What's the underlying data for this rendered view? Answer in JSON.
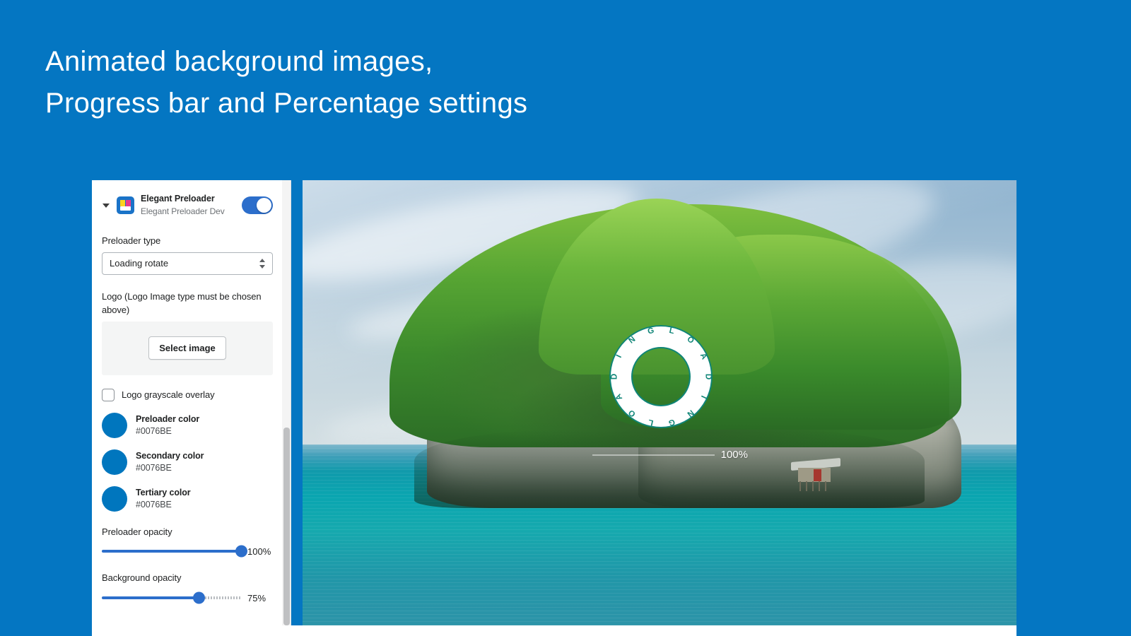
{
  "page": {
    "background_color": "#0476C2",
    "headline": "Animated background images,\nProgress bar and Percentage settings"
  },
  "panel": {
    "app": {
      "caret_icon": "chevron-down-icon",
      "icon": "elegant-preloader-app-icon",
      "name": "Elegant Preloader",
      "developer": "Elegant Preloader Dev",
      "toggle_state": "on"
    },
    "preloader_type": {
      "label": "Preloader type",
      "value": "Loading rotate",
      "options": [
        "Loading rotate"
      ],
      "arrow_icon": "select-arrows-icon"
    },
    "logo": {
      "label": "Logo (Logo Image type must be chosen above)",
      "button_label": "Select image"
    },
    "grayscale": {
      "label": "Logo grayscale overlay",
      "checked": false
    },
    "colors": [
      {
        "name": "Preloader color",
        "hex": "#0076BE"
      },
      {
        "name": "Secondary color",
        "hex": "#0076BE"
      },
      {
        "name": "Tertiary color",
        "hex": "#0076BE"
      }
    ],
    "sliders": [
      {
        "label": "Preloader opacity",
        "value": "100%",
        "percent": 100
      },
      {
        "label": "Background opacity",
        "value": "75%",
        "percent": 75
      }
    ],
    "scrollbar": {
      "name": "panel-scrollbar"
    }
  },
  "preview": {
    "alt": "tropical island with green vegetation and turquoise sea",
    "spinner": {
      "text": "LOADING",
      "repeats": 2,
      "ring_color": "#0F8577",
      "fill_color": "#FFFFFF"
    },
    "progress": {
      "percent_label": "100%",
      "percent": 100,
      "bar_color": "#FFFFFF"
    }
  }
}
